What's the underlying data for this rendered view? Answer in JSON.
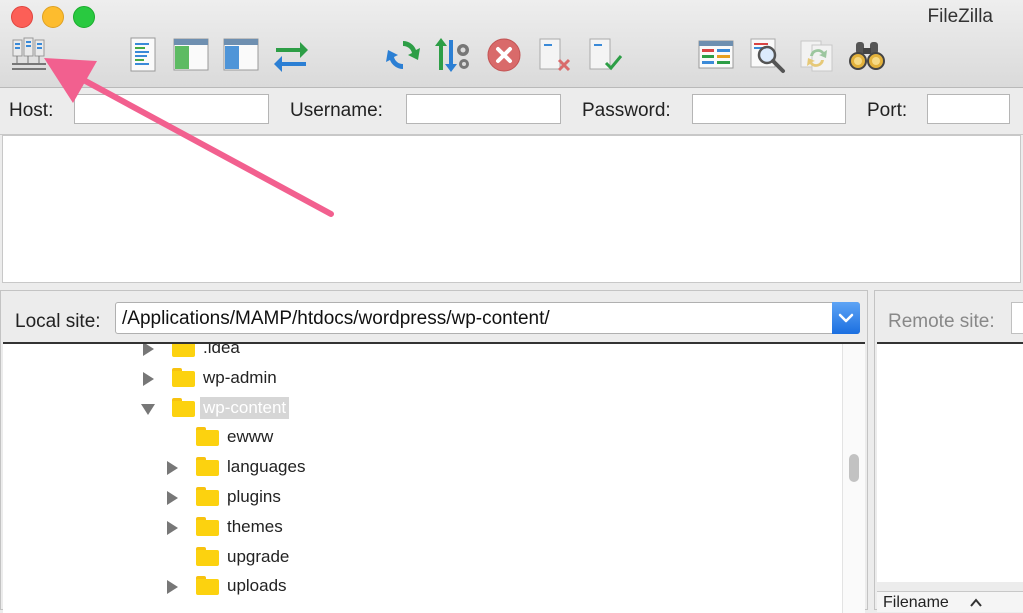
{
  "window": {
    "title": "FileZilla"
  },
  "toolbar": {
    "icons": [
      "site-manager-icon",
      "message-log-icon",
      "local-tree-icon",
      "remote-tree-icon",
      "transfer-queue-icon",
      "refresh-icon",
      "process-queue-icon",
      "cancel-icon",
      "disconnect-icon",
      "reconnect-icon",
      "directory-listing-filters-icon",
      "search-files-icon",
      "synchronized-browsing-icon",
      "find-files-icon"
    ]
  },
  "quickconnect": {
    "host_label": "Host:",
    "host_value": "",
    "username_label": "Username:",
    "username_value": "",
    "password_label": "Password:",
    "password_value": "",
    "port_label": "Port:",
    "port_value": ""
  },
  "local": {
    "label": "Local site:",
    "path": "/Applications/MAMP/htdocs/wordpress/wp-content/",
    "tree": [
      {
        "name": ".idea",
        "expander": "collapsed",
        "depth": 0,
        "selected": false
      },
      {
        "name": "wp-admin",
        "expander": "collapsed",
        "depth": 0,
        "selected": false
      },
      {
        "name": "wp-content",
        "expander": "expanded",
        "depth": 0,
        "selected": true
      },
      {
        "name": "ewww",
        "expander": "none",
        "depth": 1,
        "selected": false
      },
      {
        "name": "languages",
        "expander": "collapsed",
        "depth": 1,
        "selected": false
      },
      {
        "name": "plugins",
        "expander": "collapsed",
        "depth": 1,
        "selected": false
      },
      {
        "name": "themes",
        "expander": "collapsed",
        "depth": 1,
        "selected": false
      },
      {
        "name": "upgrade",
        "expander": "none",
        "depth": 1,
        "selected": false
      },
      {
        "name": "uploads",
        "expander": "collapsed",
        "depth": 1,
        "selected": false
      }
    ]
  },
  "remote": {
    "label": "Remote site:",
    "list_header": {
      "filename": "Filename"
    }
  },
  "colors": {
    "annotation_arrow": "#f2608f",
    "folder": "#fcd20f",
    "selection": "#d6d6d6",
    "combo_button": "#1b6fe0"
  }
}
